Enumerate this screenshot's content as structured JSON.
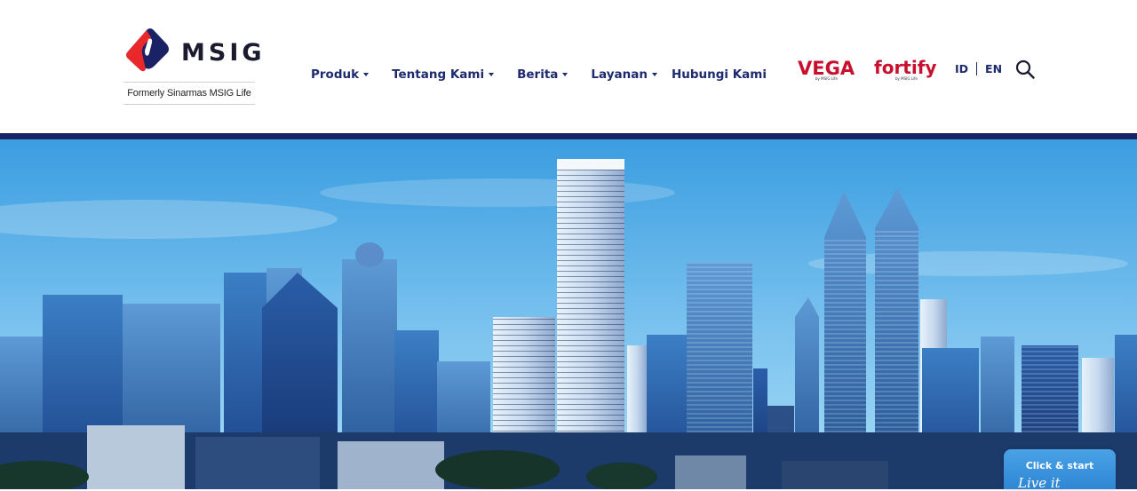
{
  "header": {
    "logo": {
      "word": "MSIG",
      "subtitle": "Formerly Sinarmas MSIG Life",
      "colors": {
        "red": "#e8282b",
        "navy": "#1b2165"
      }
    },
    "nav": [
      {
        "label": "Produk",
        "has_dropdown": true
      },
      {
        "label": "Tentang Kami",
        "has_dropdown": true
      },
      {
        "label": "Berita",
        "has_dropdown": true
      },
      {
        "label": "Layanan",
        "has_dropdown": true
      },
      {
        "label": "Hubungi Kami",
        "has_dropdown": false
      }
    ],
    "brands": {
      "vega": {
        "name": "VEGA",
        "tagline": "by MSIG Life",
        "color": "#c8102e"
      },
      "fortify": {
        "name": "fortify",
        "tagline": "by MSIG Life",
        "color": "#c8102e",
        "secondary": "#2d2a7a"
      }
    },
    "language": {
      "options": [
        "ID",
        "EN"
      ]
    },
    "search": {
      "icon": "search-icon"
    }
  },
  "hero": {
    "image": "jakarta-city-skyline",
    "sky_colors": [
      "#3a9de0",
      "#8dcdf3"
    ]
  },
  "cta": {
    "title": "Click & start",
    "script_text": "Live it"
  },
  "accent_color": "#1e2a6e"
}
